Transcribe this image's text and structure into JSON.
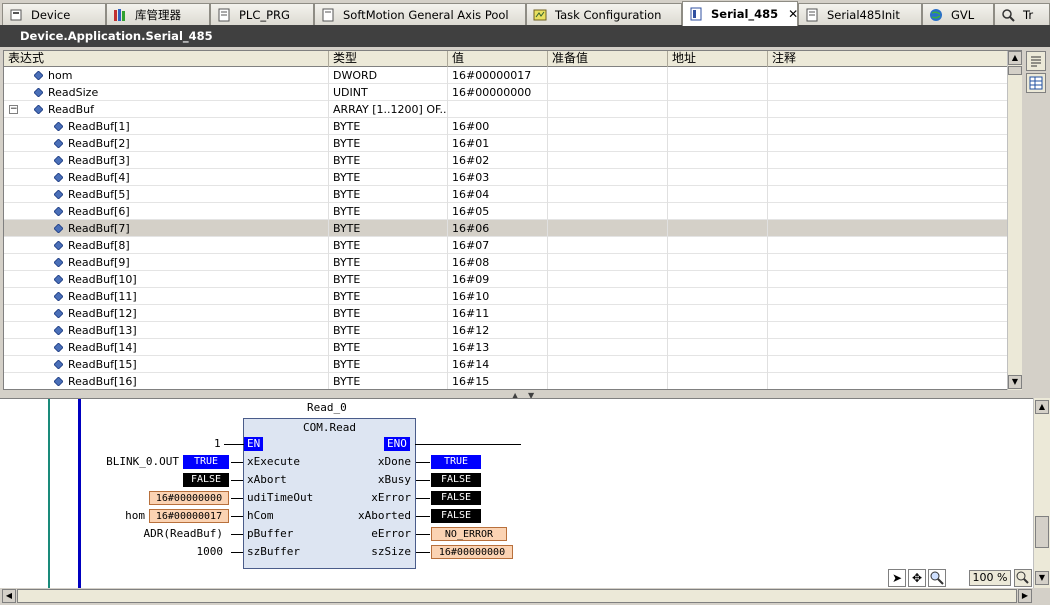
{
  "tabs": [
    {
      "label": "Device",
      "icon": "device-icon"
    },
    {
      "label": "库管理器",
      "icon": "library-icon"
    },
    {
      "label": "PLC_PRG",
      "icon": "pou-icon"
    },
    {
      "label": "SoftMotion General Axis Pool",
      "icon": "folder-icon"
    },
    {
      "label": "Task Configuration",
      "icon": "task-icon"
    },
    {
      "label": "Serial_485",
      "icon": "pou-icon",
      "active": true,
      "close": "✕"
    },
    {
      "label": "Serial485Init",
      "icon": "pou-icon"
    },
    {
      "label": "GVL",
      "icon": "globe-icon"
    },
    {
      "label": "Tr",
      "icon": "trace-icon"
    }
  ],
  "title": "Device.Application.Serial_485",
  "watch": {
    "columns": [
      "表达式",
      "类型",
      "值",
      "准备值",
      "地址",
      "注释"
    ],
    "rows": [
      {
        "name": "hom",
        "type": "DWORD",
        "value": "16#00000017",
        "level": 0
      },
      {
        "name": "ReadSize",
        "type": "UDINT",
        "value": "16#00000000",
        "level": 0
      },
      {
        "name": "ReadBuf",
        "type": "ARRAY [1..1200] OF...",
        "value": "",
        "level": 0,
        "expander": "−"
      },
      {
        "name": "ReadBuf[1]",
        "type": "BYTE",
        "value": "16#00",
        "level": 1
      },
      {
        "name": "ReadBuf[2]",
        "type": "BYTE",
        "value": "16#01",
        "level": 1
      },
      {
        "name": "ReadBuf[3]",
        "type": "BYTE",
        "value": "16#02",
        "level": 1
      },
      {
        "name": "ReadBuf[4]",
        "type": "BYTE",
        "value": "16#03",
        "level": 1
      },
      {
        "name": "ReadBuf[5]",
        "type": "BYTE",
        "value": "16#04",
        "level": 1
      },
      {
        "name": "ReadBuf[6]",
        "type": "BYTE",
        "value": "16#05",
        "level": 1
      },
      {
        "name": "ReadBuf[7]",
        "type": "BYTE",
        "value": "16#06",
        "level": 1,
        "selected": true
      },
      {
        "name": "ReadBuf[8]",
        "type": "BYTE",
        "value": "16#07",
        "level": 1
      },
      {
        "name": "ReadBuf[9]",
        "type": "BYTE",
        "value": "16#08",
        "level": 1
      },
      {
        "name": "ReadBuf[10]",
        "type": "BYTE",
        "value": "16#09",
        "level": 1
      },
      {
        "name": "ReadBuf[11]",
        "type": "BYTE",
        "value": "16#10",
        "level": 1
      },
      {
        "name": "ReadBuf[12]",
        "type": "BYTE",
        "value": "16#11",
        "level": 1
      },
      {
        "name": "ReadBuf[13]",
        "type": "BYTE",
        "value": "16#12",
        "level": 1
      },
      {
        "name": "ReadBuf[14]",
        "type": "BYTE",
        "value": "16#13",
        "level": 1
      },
      {
        "name": "ReadBuf[15]",
        "type": "BYTE",
        "value": "16#14",
        "level": 1
      },
      {
        "name": "ReadBuf[16]",
        "type": "BYTE",
        "value": "16#15",
        "level": 1
      }
    ]
  },
  "fbd": {
    "instance": "Read_0",
    "type": "COM.Read",
    "en_input": "1",
    "en_label": "EN",
    "eno_label": "ENO",
    "inputs": [
      {
        "pin": "xExecute",
        "var": "BLINK_0.OUT",
        "badge": "TRUE",
        "badge_style": "blue"
      },
      {
        "pin": "xAbort",
        "var": "",
        "badge": "FALSE",
        "badge_style": "black"
      },
      {
        "pin": "udiTimeOut",
        "var": "",
        "badge": "16#00000000",
        "badge_style": "orange"
      },
      {
        "pin": "hCom",
        "var": "hom",
        "badge": "16#00000017",
        "badge_style": "orange"
      },
      {
        "pin": "pBuffer",
        "var": "ADR(ReadBuf)",
        "badge": "",
        "badge_style": ""
      },
      {
        "pin": "szBuffer",
        "var": "1000",
        "badge": "",
        "badge_style": ""
      }
    ],
    "outputs": [
      {
        "pin": "xDone",
        "badge": "TRUE",
        "badge_style": "blue"
      },
      {
        "pin": "xBusy",
        "badge": "FALSE",
        "badge_style": "black"
      },
      {
        "pin": "xError",
        "badge": "FALSE",
        "badge_style": "black"
      },
      {
        "pin": "xAborted",
        "badge": "FALSE",
        "badge_style": "black"
      },
      {
        "pin": "eError",
        "badge": "NO_ERROR",
        "badge_style": "orange"
      },
      {
        "pin": "szSize",
        "badge": "16#00000000",
        "badge_style": "orange"
      }
    ]
  },
  "zoom": "100 %"
}
